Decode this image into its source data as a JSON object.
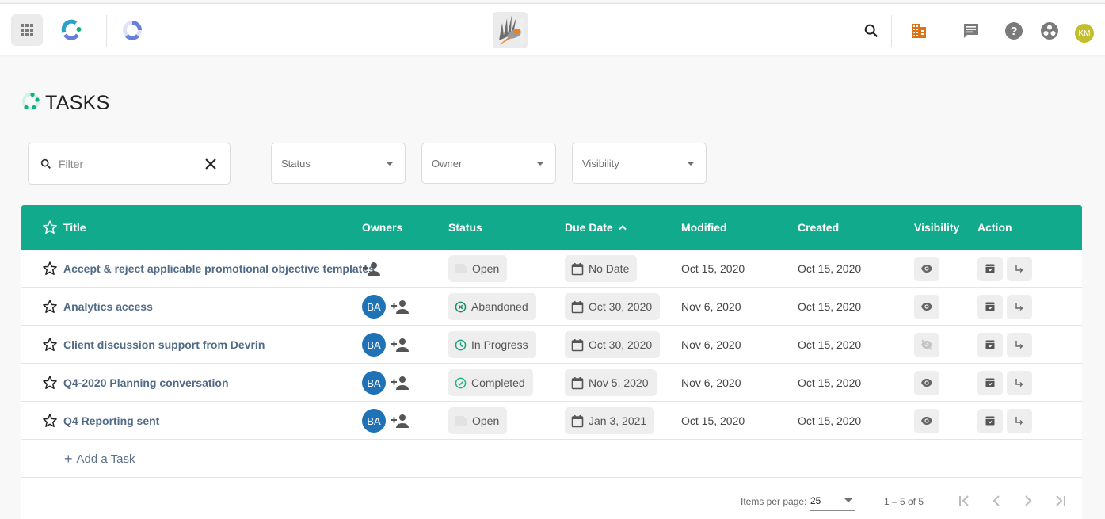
{
  "topbar": {
    "apps_icon": "apps-grid-icon",
    "logo_primary": "app-logo-icon",
    "logo_secondary": "product-logo-icon",
    "center_logo": "bird-logo-icon",
    "search_icon": "search-icon",
    "org_icon": "building-icon",
    "chat_icon": "chat-icon",
    "help_icon": "help-icon",
    "hub_icon": "hub-icon",
    "user_initials": "KM",
    "colors": {
      "org": "#d9731c",
      "avatar": "#c3bf2c"
    }
  },
  "page": {
    "title": "TASKS",
    "title_icon": "tasks-logo-icon"
  },
  "filters": {
    "search_placeholder": "Filter",
    "search_value": "",
    "status_label": "Status",
    "owner_label": "Owner",
    "visibility_label": "Visibility"
  },
  "table": {
    "header_color": "#12aa8c",
    "columns": {
      "title": "Title",
      "owners": "Owners",
      "status": "Status",
      "due_date": "Due Date",
      "modified": "Modified",
      "created": "Created",
      "visibility": "Visibility",
      "action": "Action"
    },
    "sort": {
      "column": "due_date",
      "direction": "ascending"
    },
    "rows": [
      {
        "title": "Accept & reject applicable promotional objective templates",
        "owner": "",
        "status": "Open",
        "status_icon": "open-status-icon",
        "due": "No Date",
        "modified": "Oct 15, 2020",
        "created": "Oct 15, 2020",
        "visible": true
      },
      {
        "title": "Analytics access",
        "owner": "BA",
        "status": "Abandoned",
        "status_icon": "cancel-circle-icon",
        "due": "Oct 30, 2020",
        "modified": "Nov 6, 2020",
        "created": "Oct 15, 2020",
        "visible": true
      },
      {
        "title": "Client discussion support from Devrin",
        "owner": "BA",
        "status": "In Progress",
        "status_icon": "clock-icon",
        "due": "Oct 30, 2020",
        "modified": "Nov 6, 2020",
        "created": "Oct 15, 2020",
        "visible": false
      },
      {
        "title": "Q4-2020 Planning conversation",
        "owner": "BA",
        "status": "Completed",
        "status_icon": "check-circle-icon",
        "due": "Nov 5, 2020",
        "modified": "Nov 6, 2020",
        "created": "Oct 15, 2020",
        "visible": true
      },
      {
        "title": "Q4 Reporting sent",
        "owner": "BA",
        "status": "Open",
        "status_icon": "open-status-icon",
        "due": "Jan 3, 2021",
        "modified": "Oct 15, 2020",
        "created": "Oct 15, 2020",
        "visible": true
      }
    ],
    "add_task_label": "Add a Task",
    "owner_color": "#1e72b5",
    "title_color": "#516a85"
  },
  "paginator": {
    "items_per_page_label": "Items per page:",
    "items_per_page": "25",
    "range": "1 – 5 of 5"
  }
}
